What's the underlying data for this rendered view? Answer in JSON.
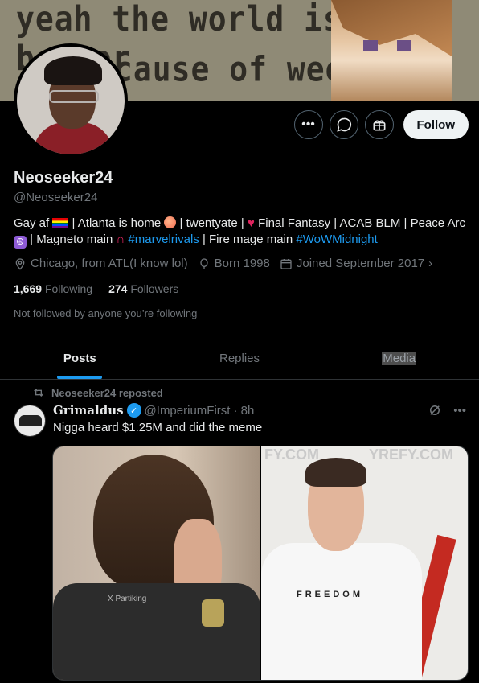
{
  "banner": {
    "line1": "yeah the world is a better",
    "line2": "cause of weed"
  },
  "profile": {
    "name": "Neoseeker24",
    "handle": "@Neoseeker24",
    "bio": {
      "p1": "Gay af",
      "p2": "| Atlanta is home",
      "p3": "| twentyate |",
      "p4": "Final Fantasy | ACAB BLM | Peace Arc",
      "p5": "| Magneto main",
      "hashtag1": "#marvelrivals",
      "p6": "| Fire mage main",
      "hashtag2": "#WoWMidnight"
    },
    "location": "Chicago, from ATL(I know lol)",
    "born": "Born 1998",
    "joined": "Joined September 2017",
    "following_count": "1,669",
    "following_label": "Following",
    "followers_count": "274",
    "followers_label": "Followers",
    "not_followed": "Not followed by anyone you’re following"
  },
  "actions": {
    "more_icon": "more-icon",
    "message_icon": "message-icon",
    "gift_icon": "gift-icon",
    "follow_label": "Follow"
  },
  "tabs": [
    {
      "label": "Posts",
      "active": true
    },
    {
      "label": "Replies",
      "active": false
    },
    {
      "label": "Media",
      "active": false
    }
  ],
  "post": {
    "repost_label": "Neoseeker24 reposted",
    "author": "Grimaldus",
    "author_handle": "@ImperiumFirst",
    "time": "· 8h",
    "text": "Nigga heard $1.25M and did the meme",
    "media": {
      "left_watermark": "X Partiking",
      "right_text_top_left": "FY.COM",
      "right_text_top_right": "YREFY.COM",
      "right_shirt": "FREEDOM"
    }
  },
  "colors": {
    "accent": "#1d9bf0",
    "text": "#e7e9ea",
    "muted": "#71767b",
    "background": "#000000"
  }
}
